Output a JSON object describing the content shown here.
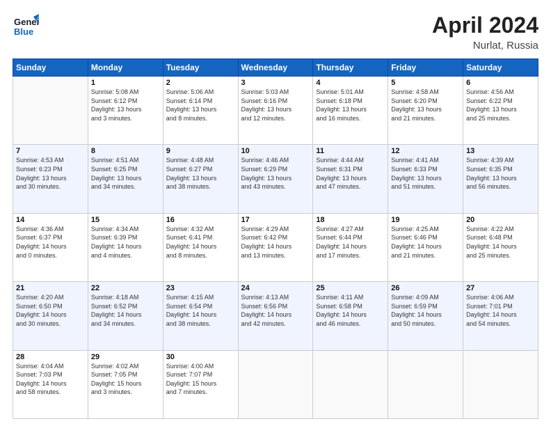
{
  "header": {
    "logo_line1": "General",
    "logo_line2": "Blue",
    "title": "April 2024",
    "subtitle": "Nurlat, Russia"
  },
  "columns": [
    "Sunday",
    "Monday",
    "Tuesday",
    "Wednesday",
    "Thursday",
    "Friday",
    "Saturday"
  ],
  "rows": [
    [
      {
        "day": "",
        "info": ""
      },
      {
        "day": "1",
        "info": "Sunrise: 5:08 AM\nSunset: 6:12 PM\nDaylight: 13 hours\nand 3 minutes."
      },
      {
        "day": "2",
        "info": "Sunrise: 5:06 AM\nSunset: 6:14 PM\nDaylight: 13 hours\nand 8 minutes."
      },
      {
        "day": "3",
        "info": "Sunrise: 5:03 AM\nSunset: 6:16 PM\nDaylight: 13 hours\nand 12 minutes."
      },
      {
        "day": "4",
        "info": "Sunrise: 5:01 AM\nSunset: 6:18 PM\nDaylight: 13 hours\nand 16 minutes."
      },
      {
        "day": "5",
        "info": "Sunrise: 4:58 AM\nSunset: 6:20 PM\nDaylight: 13 hours\nand 21 minutes."
      },
      {
        "day": "6",
        "info": "Sunrise: 4:56 AM\nSunset: 6:22 PM\nDaylight: 13 hours\nand 25 minutes."
      }
    ],
    [
      {
        "day": "7",
        "info": "Sunrise: 4:53 AM\nSunset: 6:23 PM\nDaylight: 13 hours\nand 30 minutes."
      },
      {
        "day": "8",
        "info": "Sunrise: 4:51 AM\nSunset: 6:25 PM\nDaylight: 13 hours\nand 34 minutes."
      },
      {
        "day": "9",
        "info": "Sunrise: 4:48 AM\nSunset: 6:27 PM\nDaylight: 13 hours\nand 38 minutes."
      },
      {
        "day": "10",
        "info": "Sunrise: 4:46 AM\nSunset: 6:29 PM\nDaylight: 13 hours\nand 43 minutes."
      },
      {
        "day": "11",
        "info": "Sunrise: 4:44 AM\nSunset: 6:31 PM\nDaylight: 13 hours\nand 47 minutes."
      },
      {
        "day": "12",
        "info": "Sunrise: 4:41 AM\nSunset: 6:33 PM\nDaylight: 13 hours\nand 51 minutes."
      },
      {
        "day": "13",
        "info": "Sunrise: 4:39 AM\nSunset: 6:35 PM\nDaylight: 13 hours\nand 56 minutes."
      }
    ],
    [
      {
        "day": "14",
        "info": "Sunrise: 4:36 AM\nSunset: 6:37 PM\nDaylight: 14 hours\nand 0 minutes."
      },
      {
        "day": "15",
        "info": "Sunrise: 4:34 AM\nSunset: 6:39 PM\nDaylight: 14 hours\nand 4 minutes."
      },
      {
        "day": "16",
        "info": "Sunrise: 4:32 AM\nSunset: 6:41 PM\nDaylight: 14 hours\nand 8 minutes."
      },
      {
        "day": "17",
        "info": "Sunrise: 4:29 AM\nSunset: 6:42 PM\nDaylight: 14 hours\nand 13 minutes."
      },
      {
        "day": "18",
        "info": "Sunrise: 4:27 AM\nSunset: 6:44 PM\nDaylight: 14 hours\nand 17 minutes."
      },
      {
        "day": "19",
        "info": "Sunrise: 4:25 AM\nSunset: 6:46 PM\nDaylight: 14 hours\nand 21 minutes."
      },
      {
        "day": "20",
        "info": "Sunrise: 4:22 AM\nSunset: 6:48 PM\nDaylight: 14 hours\nand 25 minutes."
      }
    ],
    [
      {
        "day": "21",
        "info": "Sunrise: 4:20 AM\nSunset: 6:50 PM\nDaylight: 14 hours\nand 30 minutes."
      },
      {
        "day": "22",
        "info": "Sunrise: 4:18 AM\nSunset: 6:52 PM\nDaylight: 14 hours\nand 34 minutes."
      },
      {
        "day": "23",
        "info": "Sunrise: 4:15 AM\nSunset: 6:54 PM\nDaylight: 14 hours\nand 38 minutes."
      },
      {
        "day": "24",
        "info": "Sunrise: 4:13 AM\nSunset: 6:56 PM\nDaylight: 14 hours\nand 42 minutes."
      },
      {
        "day": "25",
        "info": "Sunrise: 4:11 AM\nSunset: 6:58 PM\nDaylight: 14 hours\nand 46 minutes."
      },
      {
        "day": "26",
        "info": "Sunrise: 4:09 AM\nSunset: 6:59 PM\nDaylight: 14 hours\nand 50 minutes."
      },
      {
        "day": "27",
        "info": "Sunrise: 4:06 AM\nSunset: 7:01 PM\nDaylight: 14 hours\nand 54 minutes."
      }
    ],
    [
      {
        "day": "28",
        "info": "Sunrise: 4:04 AM\nSunset: 7:03 PM\nDaylight: 14 hours\nand 58 minutes."
      },
      {
        "day": "29",
        "info": "Sunrise: 4:02 AM\nSunset: 7:05 PM\nDaylight: 15 hours\nand 3 minutes."
      },
      {
        "day": "30",
        "info": "Sunrise: 4:00 AM\nSunset: 7:07 PM\nDaylight: 15 hours\nand 7 minutes."
      },
      {
        "day": "",
        "info": ""
      },
      {
        "day": "",
        "info": ""
      },
      {
        "day": "",
        "info": ""
      },
      {
        "day": "",
        "info": ""
      }
    ]
  ]
}
